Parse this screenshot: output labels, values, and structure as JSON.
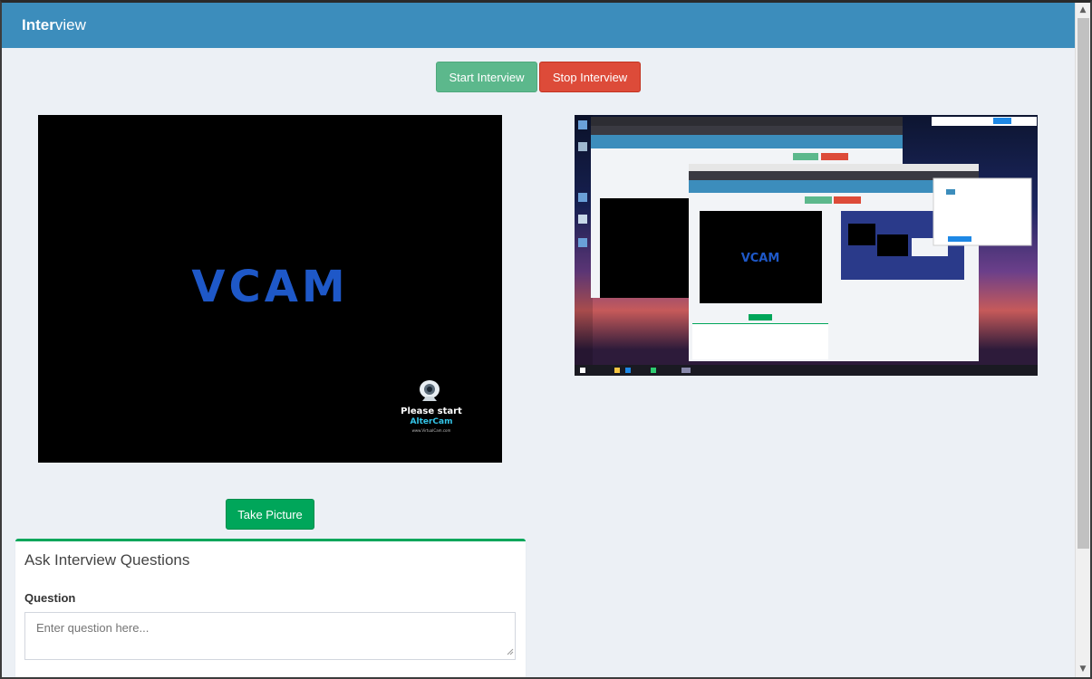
{
  "header": {
    "title_bold": "Inter",
    "title_light": "view"
  },
  "controls": {
    "start_label": "Start Interview",
    "stop_label": "Stop Interview"
  },
  "video": {
    "logo_text": "VCAM",
    "badge_line1": "Please start",
    "badge_line2": "AlterCam",
    "badge_line3": "www.VirtualCam.com"
  },
  "take_picture_label": "Take Picture",
  "questions_box": {
    "title": "Ask Interview Questions",
    "question_label": "Question",
    "question_placeholder": "Enter question here...",
    "question_value": ""
  },
  "colors": {
    "header": "#3c8dbc",
    "start": "#5cb88c",
    "stop": "#dd4b39",
    "take_picture": "#00a65a",
    "background": "#ecf0f5"
  },
  "icons": [
    "scroll-up-arrow-icon",
    "scroll-down-arrow-icon",
    "webcam-icon",
    "resize-grip-icon"
  ]
}
